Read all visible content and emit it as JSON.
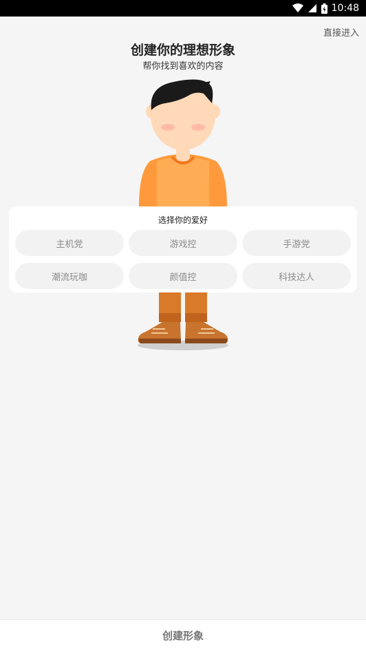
{
  "status_bar": {
    "time": "10:48"
  },
  "header": {
    "skip_label": "直接进入",
    "title": "创建你的理想形象",
    "subtitle": "帮你找到喜欢的内容"
  },
  "hobbies": {
    "title": "选择你的爱好",
    "options": [
      "主机党",
      "游戏控",
      "手游党",
      "潮流玩咖",
      "颜值控",
      "科技达人"
    ]
  },
  "footer": {
    "create_label": "创建形象"
  },
  "colors": {
    "background": "#f5f5f5",
    "shirt": "#ff9a3c",
    "pants": "#d9792a",
    "skin": "#ffd9b8",
    "hair": "#1a1a1a"
  },
  "icons": [
    "wifi-icon",
    "signal-icon",
    "battery-icon"
  ]
}
